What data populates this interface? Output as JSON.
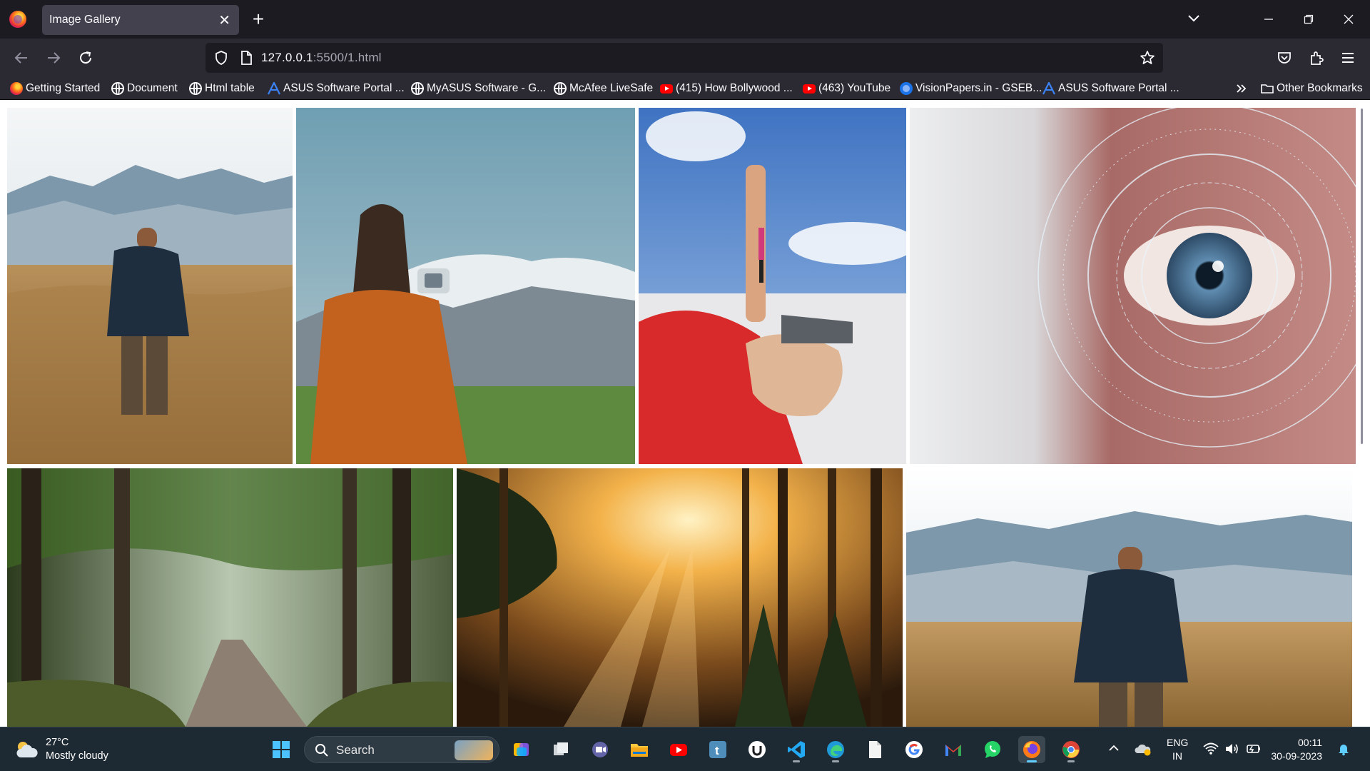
{
  "browser": {
    "tab_title": "Image Gallery",
    "url_host": "127.0.0.1",
    "url_rest": ":5500/1.html"
  },
  "bookmarks": [
    {
      "label": "Getting Started",
      "icon": "firefox-icon"
    },
    {
      "label": "Document",
      "icon": "globe-icon"
    },
    {
      "label": "Html table",
      "icon": "globe-icon"
    },
    {
      "label": "ASUS Software Portal ...",
      "icon": "asus-icon"
    },
    {
      "label": "MyASUS Software - G...",
      "icon": "globe-icon"
    },
    {
      "label": "McAfee LiveSafe",
      "icon": "globe-icon"
    },
    {
      "label": "(415) How Bollywood ...",
      "icon": "youtube-icon"
    },
    {
      "label": "(463) YouTube",
      "icon": "youtube-icon"
    },
    {
      "label": "VisionPapers.in - GSEB...",
      "icon": "visionpapers-icon"
    },
    {
      "label": "ASUS Software Portal ...",
      "icon": "asus-icon"
    }
  ],
  "other_bookmarks_label": "Other Bookmarks",
  "gallery": [
    {
      "subject": "man in jacket standing in golden field with mountains"
    },
    {
      "subject": "woman in orange jacket photographing snowy mountain"
    },
    {
      "subject": "man holding tiny person on salt flat (forced perspective)"
    },
    {
      "subject": "close-up of blue eye with digital HUD rings"
    },
    {
      "subject": "sunlit forest road between tall trees"
    },
    {
      "subject": "golden sun rays through pine forest"
    },
    {
      "subject": "man in jacket standing in golden field with mountains"
    }
  ],
  "taskbar": {
    "weather_temp": "27°C",
    "weather_desc": "Mostly cloudy",
    "search_label": "Search",
    "lang_line1": "ENG",
    "lang_line2": "IN",
    "time": "00:11",
    "date": "30-09-2023"
  },
  "colors": {
    "titlebar": "#1c1b22",
    "toolbar": "#2b2a33",
    "tab_active": "#42414d",
    "taskbar": "#1e2a33",
    "accent": "#60cdff"
  }
}
